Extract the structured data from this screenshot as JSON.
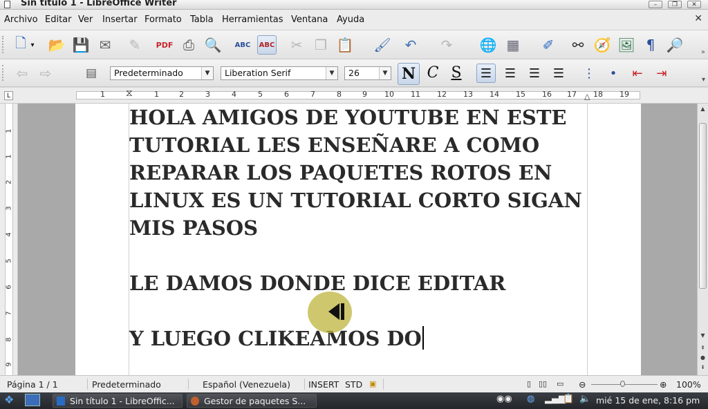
{
  "window": {
    "title": "Sin título 1 - LibreOffice Writer",
    "controls": [
      "–",
      "❐",
      "✕"
    ]
  },
  "menu": {
    "items": [
      "Archivo",
      "Editar",
      "Ver",
      "Insertar",
      "Formato",
      "Tabla",
      "Herramientas",
      "Ventana",
      "Ayuda"
    ],
    "close_doc": "✕"
  },
  "toolbar1": {
    "icons": [
      "new-document-icon",
      "open-icon",
      "save-icon",
      "email-icon",
      "edit-file-icon",
      "export-pdf-icon",
      "print-icon",
      "print-preview-icon",
      "spellcheck-icon",
      "autocheck-spelling-icon",
      "cut-icon",
      "copy-icon",
      "paste-icon",
      "format-paintbrush-icon",
      "undo-icon",
      "redo-icon",
      "hyperlink-icon",
      "table-icon",
      "draw-functions-icon",
      "find-replace-icon",
      "navigator-icon",
      "gallery-icon",
      "formatting-marks-icon",
      "zoom-icon"
    ]
  },
  "toolbar2": {
    "style_value": "Predeterminado",
    "font_value": "Liberation Serif",
    "size_value": "26",
    "bold_label": "N",
    "italic_label": "C",
    "underline_label": "S"
  },
  "ruler": {
    "numbers": [
      "1",
      "1",
      "2",
      "3",
      "4",
      "5",
      "6",
      "7",
      "8",
      "9",
      "10",
      "11",
      "12",
      "13",
      "14",
      "15",
      "16",
      "17",
      "18",
      "19"
    ],
    "vertical_numbers": [
      "1",
      "1",
      "2",
      "3",
      "4",
      "5",
      "6",
      "7",
      "8",
      "9"
    ]
  },
  "document": {
    "lines": [
      "HOLA AMIGOS DE YOUTUBE EN ESTE",
      "TUTORIAL LES ENSEÑARE A COMO",
      "REPARAR LOS PAQUETES ROTOS EN",
      "LINUX ES UN TUTORIAL CORTO SIGAN",
      "MIS PASOS",
      "",
      "LE DAMOS DONDE DICE EDITAR",
      "",
      "Y LUEGO CLIKEAMOS DO"
    ]
  },
  "status": {
    "page": "Página  1 / 1",
    "style": "Predeterminado",
    "language": "Español (Venezuela)",
    "insert": "INSERT",
    "selection": "STD",
    "zoom": "100%"
  },
  "taskbar": {
    "tasks": [
      "Sin título 1 - LibreOffic...",
      "Gestor de paquetes S..."
    ],
    "clock": "mié 15 de ene,  8:16 pm"
  }
}
